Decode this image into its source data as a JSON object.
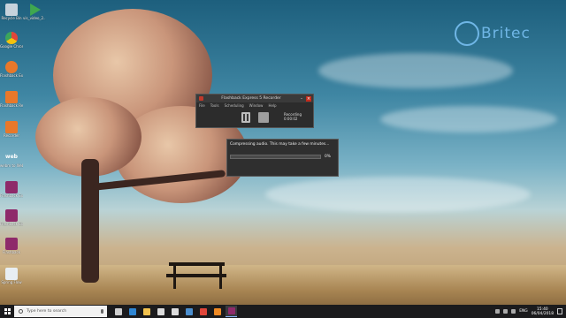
{
  "desktop": {
    "icons": [
      {
        "label": "Recycle Bin",
        "icon": "recycle-bin-icon",
        "color": "#c7d3dc"
      },
      {
        "label": "vis_video_2...",
        "icon": "video-file-icon",
        "color": "#3fa84f"
      },
      {
        "label": "Google Chrome",
        "icon": "chrome-icon",
        "color": "#e0463a"
      },
      {
        "label": "Flashback Express Manager",
        "icon": "flashback-icon",
        "color": "#e8782a"
      },
      {
        "label": "Flashback Recorder",
        "icon": "flashback-recorder-icon",
        "color": "#e8782a"
      },
      {
        "label": "Recorder",
        "icon": "recorder-icon",
        "color": "#e8782a"
      },
      {
        "label": "webm to WebM (ff...",
        "icon": "webm-icon",
        "color": "#2e7d32"
      },
      {
        "label": "Flashback Express",
        "icon": "flashback-express-icon",
        "color": "#8e2a6a"
      },
      {
        "label": "Flashback Express",
        "icon": "flashback-express-icon",
        "color": "#8e2a6a"
      },
      {
        "label": "Flashback",
        "icon": "flashback-icon",
        "color": "#8e2a6a"
      },
      {
        "label": "Flashback",
        "icon": "flashback-icon",
        "color": "#8e2a6a"
      },
      {
        "label": "Spring Flow",
        "icon": "document-icon",
        "color": "#e8eef3"
      }
    ]
  },
  "watermark": {
    "text": "Britec"
  },
  "recorder": {
    "title": "Flashback Express 5 Recorder",
    "menu": [
      "File",
      "Tools",
      "Scheduling",
      "Window",
      "Help"
    ],
    "status_label": "Recording",
    "elapsed": "0:00:02"
  },
  "dialog": {
    "message": "Compressing audio. This may take a few minutes...",
    "progress": 0,
    "percent_label": "0%"
  },
  "taskbar": {
    "search_placeholder": "Type here to search",
    "time": "15:40",
    "date": "06/04/2018",
    "language": "ENG",
    "apps": [
      {
        "icon": "task-view-icon",
        "color": "#cfcfcf"
      },
      {
        "icon": "edge-icon",
        "color": "#2f86d3"
      },
      {
        "icon": "file-explorer-icon",
        "color": "#f2c24e"
      },
      {
        "icon": "store-icon",
        "color": "#dcdcdc"
      },
      {
        "icon": "mail-icon",
        "color": "#dcdcdc"
      },
      {
        "icon": "photos-icon",
        "color": "#4c8fcf"
      },
      {
        "icon": "chrome-icon",
        "color": "#e0463a"
      },
      {
        "icon": "vlc-icon",
        "color": "#f08a24"
      },
      {
        "icon": "flashback-icon",
        "color": "#8e2a6a"
      }
    ]
  }
}
